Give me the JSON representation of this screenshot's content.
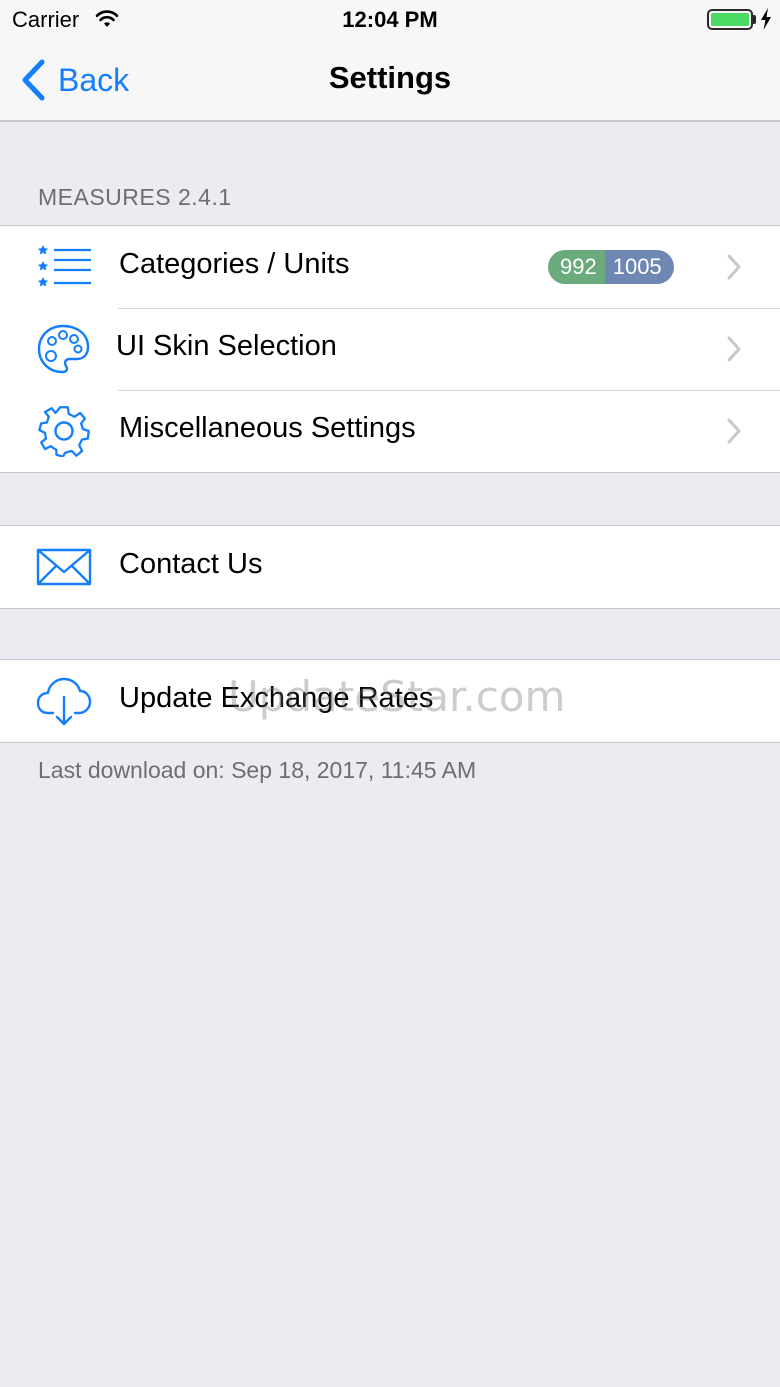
{
  "status_bar": {
    "carrier": "Carrier",
    "time": "12:04 PM",
    "battery_color": "#4cd964"
  },
  "nav": {
    "back_label": "Back",
    "title": "Settings"
  },
  "section_header": "MEASURES 2.4.1",
  "main_group": [
    {
      "icon": "list-stars-icon",
      "label": "Categories / Units",
      "badge": [
        "992",
        "1005"
      ]
    },
    {
      "icon": "palette-icon",
      "label": "UI Skin Selection"
    },
    {
      "icon": "gear-icon",
      "label": "Miscellaneous Settings"
    }
  ],
  "contact": {
    "icon": "envelope-icon",
    "label": "Contact Us"
  },
  "update": {
    "icon": "cloud-download-icon",
    "label": "Update Exchange Rates"
  },
  "footer": "Last download on: Sep 18, 2017, 11:45 AM",
  "watermark": "UpdateStar.com",
  "colors": {
    "accent": "#147efb",
    "background": "#ebebf1",
    "badge_green": "#6aaa7c",
    "badge_blue": "#6f88b3"
  }
}
